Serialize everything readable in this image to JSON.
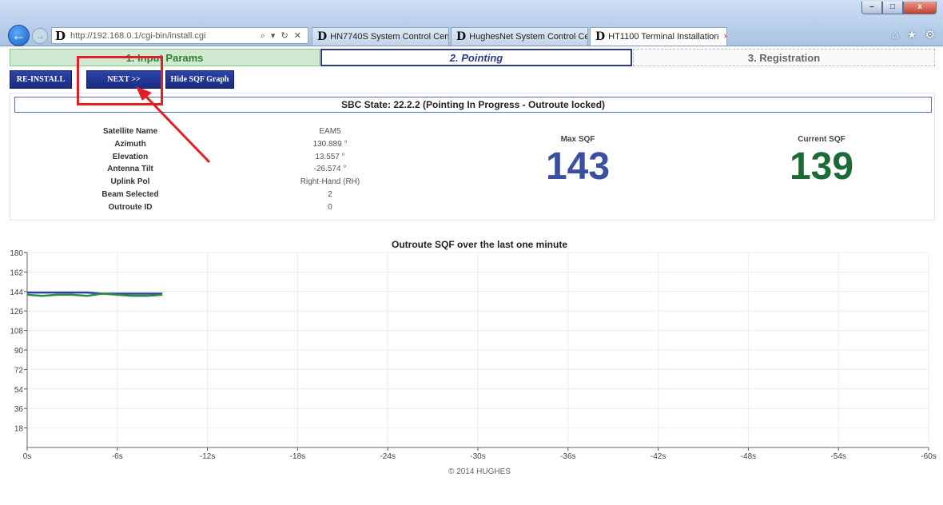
{
  "browser": {
    "address": "http://192.168.0.1/cgi-bin/install.cgi",
    "address_icons": "⌕ ▾ ↻ ✕",
    "tabs": [
      {
        "label": "HN7740S System Control Cent..."
      },
      {
        "label": "HughesNet System Control Ce..."
      },
      {
        "label": "HT1100 Terminal Installation"
      }
    ],
    "tab_close": "×",
    "window_controls": {
      "minimize": "–",
      "maximize": "□",
      "close": "x"
    }
  },
  "steps": [
    {
      "label": "1. Input Params"
    },
    {
      "label": "2. Pointing"
    },
    {
      "label": "3. Registration"
    }
  ],
  "buttons": {
    "reinstall": "RE-INSTALL",
    "next": "NEXT >>",
    "hide_graph": "Hide SQF Graph"
  },
  "state": "SBC State: 22.2.2 (Pointing In Progress - Outroute locked)",
  "info": [
    {
      "label": "Satellite Name",
      "value": "EAM5"
    },
    {
      "label": "Azimuth",
      "value": "130.889 °"
    },
    {
      "label": "Elevation",
      "value": "13.557 °"
    },
    {
      "label": "Antenna Tilt",
      "value": "-26.574 °"
    },
    {
      "label": "Uplink Pol",
      "value": "Right-Hand (RH)"
    },
    {
      "label": "Beam Selected",
      "value": "2"
    },
    {
      "label": "Outroute ID",
      "value": "0"
    }
  ],
  "sqf": {
    "max_label": "Max SQF",
    "max_value": "143",
    "current_label": "Current SQF",
    "current_value": "139"
  },
  "chart_data": {
    "type": "line",
    "title": "Outroute SQF over the last one minute",
    "x_ticks": [
      "0s",
      "-6s",
      "-12s",
      "-18s",
      "-24s",
      "-30s",
      "-36s",
      "-42s",
      "-48s",
      "-54s",
      "-60s"
    ],
    "y_ticks": [
      180,
      162,
      144,
      126,
      108,
      90,
      72,
      54,
      36,
      18
    ],
    "xlim": [
      0,
      -60
    ],
    "ylim": [
      0,
      180
    ],
    "grid": true,
    "series": [
      {
        "color": "#2f3fa8",
        "x": [
          0,
          -1,
          -2,
          -3,
          -4,
          -5,
          -6,
          -7,
          -8,
          -9
        ],
        "y": [
          143,
          143,
          143,
          143,
          143,
          142,
          142,
          142,
          142,
          142
        ]
      },
      {
        "color": "#2b8a3e",
        "x": [
          0,
          -1,
          -2,
          -3,
          -4,
          -5,
          -6,
          -7,
          -8,
          -9
        ],
        "y": [
          141,
          140,
          141,
          141,
          140,
          142,
          141,
          140,
          140,
          141
        ]
      }
    ]
  },
  "footer": "© 2014 HUGHES"
}
